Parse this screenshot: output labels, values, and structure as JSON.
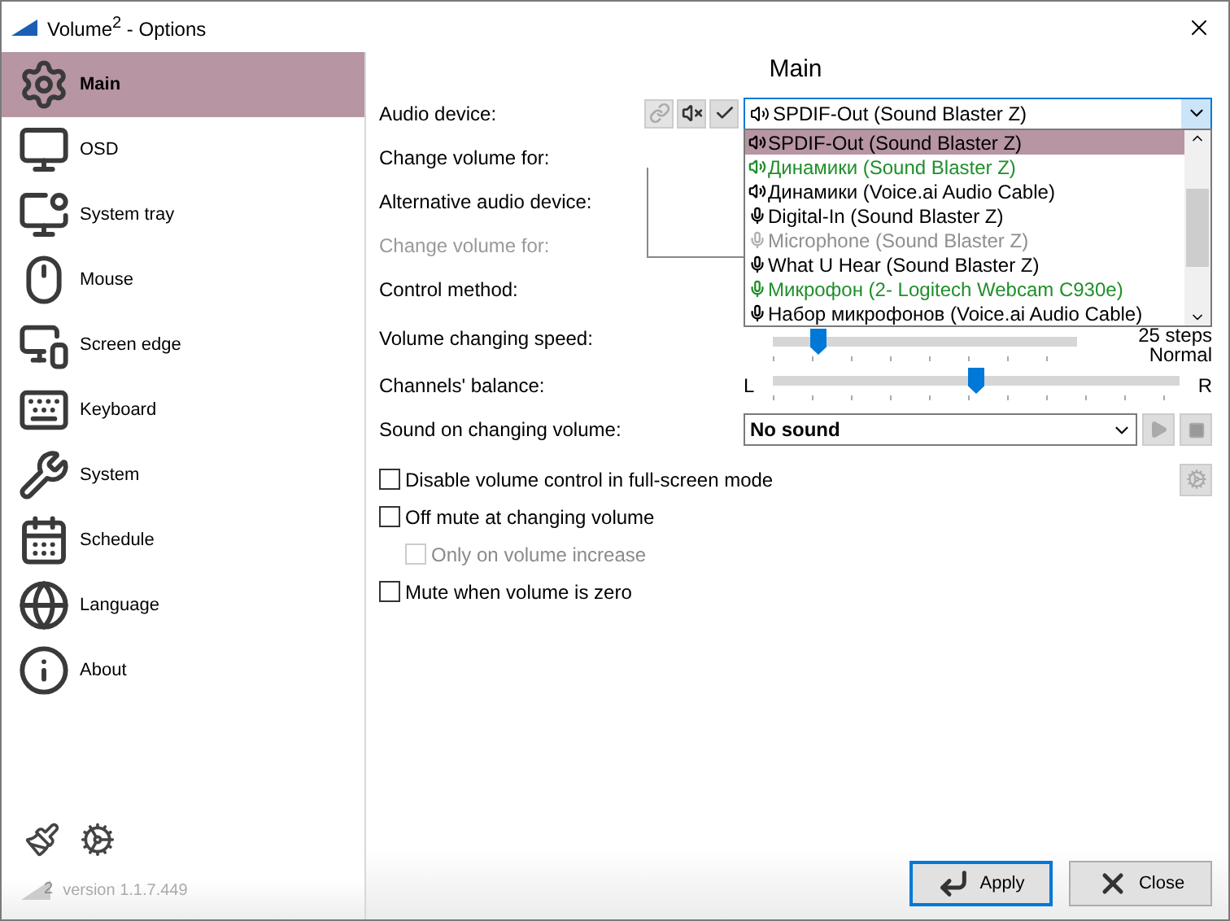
{
  "window": {
    "title": "Volume$^{2}$ - Options"
  },
  "sidebar": {
    "items": [
      {
        "label": "Main",
        "kind": "gear",
        "selected": true
      },
      {
        "label": "OSD",
        "kind": "monitor",
        "selected": false
      },
      {
        "label": "System tray",
        "kind": "tray",
        "selected": false
      },
      {
        "label": "Mouse",
        "kind": "mouse",
        "selected": false
      },
      {
        "label": "Screen edge",
        "kind": "edge",
        "selected": false
      },
      {
        "label": "Keyboard",
        "kind": "keyboard",
        "selected": false
      },
      {
        "label": "System",
        "kind": "tools",
        "selected": false
      },
      {
        "label": "Schedule",
        "kind": "calendar",
        "selected": false
      },
      {
        "label": "Language",
        "kind": "globe",
        "selected": false
      },
      {
        "label": "About",
        "kind": "info",
        "selected": false
      }
    ],
    "version_badge": "2",
    "version": "version 1.1.7.449"
  },
  "main": {
    "heading": "Main",
    "audio_device": {
      "label": "Audio device:",
      "value": "SPDIF-Out (Sound Blaster Z)",
      "expanded": true,
      "tools": [
        {
          "kind": "link",
          "disabled": true
        },
        {
          "kind": "mute",
          "disabled": false
        },
        {
          "kind": "check",
          "disabled": false
        }
      ]
    },
    "device_list": [
      {
        "label": "SPDIF-Out (Sound Blaster Z)",
        "kind": "speaker",
        "color": "#000000",
        "selected": true,
        "disabled": false
      },
      {
        "label": "Динамики (Sound Blaster Z)",
        "kind": "speaker",
        "color": "#1f8f2a",
        "selected": false,
        "disabled": false
      },
      {
        "label": "Динамики (Voice.ai Audio Cable)",
        "kind": "speaker",
        "color": "#000000",
        "selected": false,
        "disabled": false
      },
      {
        "label": "Digital-In (Sound Blaster Z)",
        "kind": "mic",
        "color": "#000000",
        "selected": false,
        "disabled": false
      },
      {
        "label": "Microphone (Sound Blaster Z)",
        "kind": "mic",
        "color": "#8f8f8f",
        "selected": false,
        "disabled": true
      },
      {
        "label": "What U Hear (Sound Blaster Z)",
        "kind": "mic",
        "color": "#000000",
        "selected": false,
        "disabled": false
      },
      {
        "label": "Микрофон (2- Logitech Webcam C930e)",
        "kind": "mic",
        "color": "#1f8f2a",
        "selected": false,
        "disabled": false
      },
      {
        "label": "Набор микрофонов (Voice.ai Audio Cable)",
        "kind": "mic",
        "color": "#000000",
        "selected": false,
        "disabled": false
      }
    ],
    "rows": [
      {
        "label": "Change volume for:",
        "disabled": false
      },
      {
        "label": "Alternative audio device:",
        "disabled": false
      },
      {
        "label": "Change volume for:",
        "disabled": true
      },
      {
        "label": "Control method:",
        "disabled": false
      }
    ],
    "speed": {
      "label": "Volume changing speed:",
      "level": 0.15,
      "reading": "25 steps",
      "caption": "Normal"
    },
    "balance": {
      "label": "Channels' balance:",
      "left": "L",
      "right": "R",
      "level": 0.5
    },
    "sound": {
      "label": "Sound on changing volume:",
      "value": "No sound"
    },
    "checkboxes": [
      {
        "label": "Disable volume control in full-screen mode",
        "checked": false,
        "disabled": false,
        "settings": true
      },
      {
        "label": "Off mute at changing volume",
        "checked": false,
        "disabled": false,
        "children": [
          {
            "label": "Only on volume increase",
            "checked": false,
            "disabled": true
          }
        ]
      },
      {
        "label": "Mute when volume is zero",
        "checked": false,
        "disabled": false
      }
    ]
  },
  "buttons": [
    {
      "label": "Apply",
      "kind": "apply",
      "focused": true
    },
    {
      "label": "Close",
      "kind": "close",
      "focused": false
    }
  ]
}
